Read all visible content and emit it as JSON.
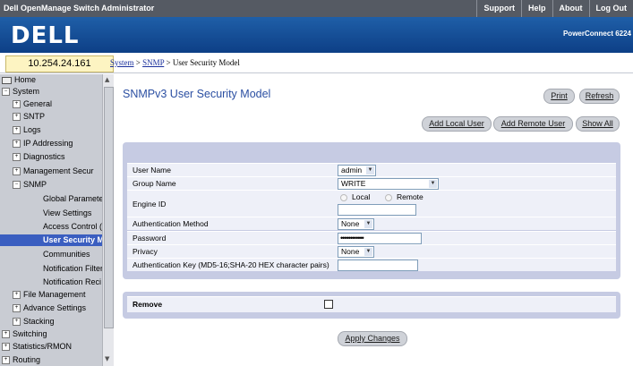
{
  "header": {
    "app_title": "Dell OpenManage Switch Administrator",
    "links": [
      "Support",
      "Help",
      "About",
      "Log Out"
    ],
    "logo_text": "DELL",
    "model": "PowerConnect 6224"
  },
  "ip_address": "10.254.24.161",
  "breadcrumb": {
    "system": "System",
    "snmp": "SNMP",
    "current": "User Security Model",
    "separator": ">"
  },
  "sidebar": {
    "items": [
      {
        "label": "Home",
        "expander": ""
      },
      {
        "label": "System",
        "expander": "−"
      },
      {
        "label": "General",
        "expander": "+"
      },
      {
        "label": "SNTP",
        "expander": "+"
      },
      {
        "label": "Logs",
        "expander": "+"
      },
      {
        "label": "IP Addressing",
        "expander": "+"
      },
      {
        "label": "Diagnostics",
        "expander": "+"
      },
      {
        "label": "Management Secur",
        "expander": "+"
      },
      {
        "label": "SNMP",
        "expander": "−"
      },
      {
        "label": "Global Paramete",
        "expander": ""
      },
      {
        "label": "View Settings",
        "expander": ""
      },
      {
        "label": "Access Control (",
        "expander": ""
      },
      {
        "label": "User Security M",
        "expander": ""
      },
      {
        "label": "Communities",
        "expander": ""
      },
      {
        "label": "Notification Filter",
        "expander": ""
      },
      {
        "label": "Notification Reci",
        "expander": ""
      },
      {
        "label": "File Management",
        "expander": "+"
      },
      {
        "label": "Advance Settings",
        "expander": "+"
      },
      {
        "label": "Stacking",
        "expander": "+"
      },
      {
        "label": "Switching",
        "expander": "+"
      },
      {
        "label": "Statistics/RMON",
        "expander": "+"
      },
      {
        "label": "Routing",
        "expander": "+"
      }
    ]
  },
  "page": {
    "title": "SNMPv3 User Security Model",
    "print_label": "Print",
    "refresh_label": "Refresh",
    "add_local_label": "Add Local User",
    "add_remote_label": "Add Remote User",
    "show_all_label": "Show All"
  },
  "form": {
    "user_name_label": "User Name",
    "user_name_value": "admin",
    "group_name_label": "Group Name",
    "group_name_value": "WRITE",
    "engine_id_label": "Engine ID",
    "engine_local_label": "Local",
    "engine_remote_label": "Remote",
    "engine_id_value": "",
    "auth_method_label": "Authentication Method",
    "auth_method_value": "None",
    "password_label": "Password",
    "password_value": "••••••••••••",
    "privacy_label": "Privacy",
    "privacy_value": "None",
    "auth_key_label": "Authentication Key (MD5-16;SHA-20 HEX character pairs)",
    "auth_key_value": "",
    "remove_label": "Remove"
  },
  "apply_label": "Apply Changes",
  "colors": {
    "topbar": "#555a63",
    "banner": "#1f5fa8",
    "title": "#2b4fa2",
    "sidebar": "#c9ccd3",
    "selected": "#3a5ec0",
    "panel": "#c6cbe3"
  }
}
